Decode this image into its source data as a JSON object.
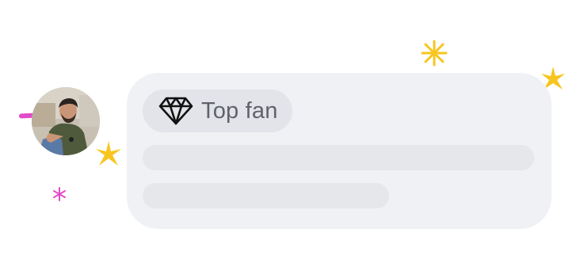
{
  "comment": {
    "badge": {
      "icon": "diamond-icon",
      "label": "Top fan"
    },
    "avatar": {
      "description_icon": "user-avatar"
    },
    "placeholder_lines": 2
  },
  "decorations": {
    "sparkle_color": "#f7c51e",
    "accent_pink": "#e14cc8"
  }
}
